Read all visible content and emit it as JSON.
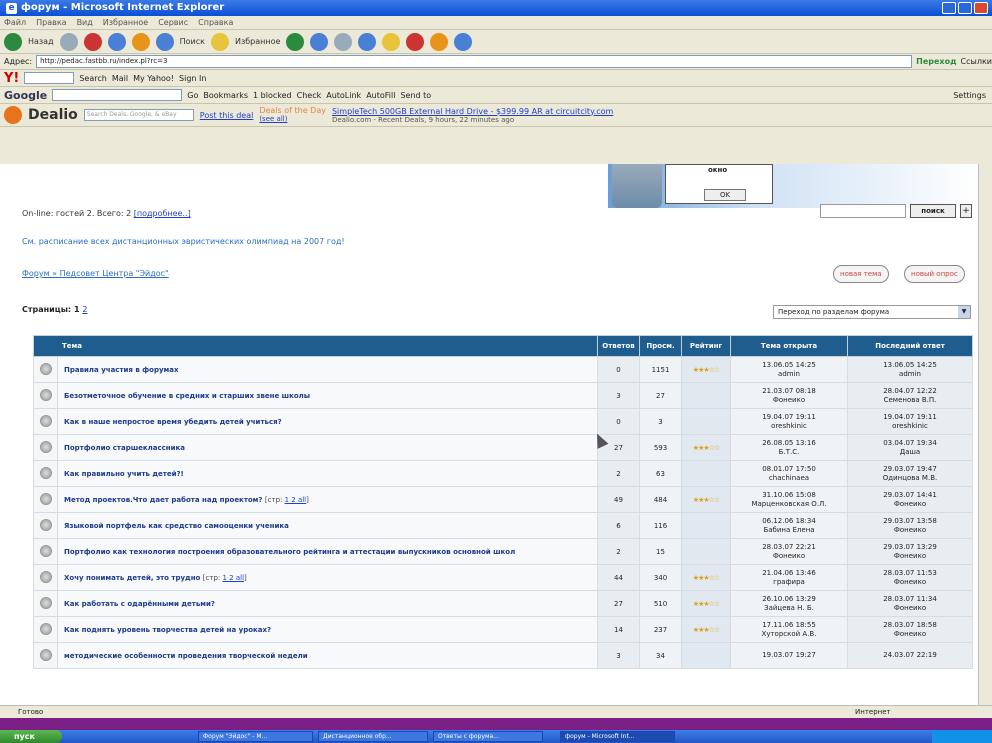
{
  "window": {
    "title": "форум - Microsoft Internet Explorer"
  },
  "menu": [
    "Файл",
    "Правка",
    "Вид",
    "Избранное",
    "Сервис",
    "Справка"
  ],
  "toolbar": {
    "back": "Назад",
    "search": "Поиск",
    "favorites": "Избранное"
  },
  "address": {
    "label": "Адрес:",
    "url": "http://pedac.fastbb.ru/index.pl?rc=3",
    "go": "Переход",
    "links": "Ссылки"
  },
  "yahoo": {
    "search": "Search",
    "mail": "Mail",
    "my_yahoo": "My Yahoo!",
    "signin": "Sign In"
  },
  "google": {
    "go": "Go",
    "bookmarks": "Bookmarks",
    "blocked": "1 blocked",
    "check": "Check",
    "autolink": "AutoLink",
    "autofill": "AutoFill",
    "sendto": "Send to",
    "settings": "Settings"
  },
  "dealio": {
    "brand": "Dealio",
    "search_placeholder": "Search Deals, Google, & eBay",
    "post": "Post this deal",
    "deals_day": "Deals of the Day",
    "see_all": "(see all)",
    "deal_link": "SimpleTech 500GB External Hard Drive - $399.99 AR at circuitcity.com",
    "deal_sub": "Dealio.com - Recent Deals, 9 hours, 22 minutes ago"
  },
  "banner": {
    "dialog_label": "окно",
    "ok": "OK"
  },
  "online": {
    "text": "On-line: гостей 2. Всего: 2",
    "link": "[подробнее..]"
  },
  "search": {
    "button": "поиск",
    "plus": "+"
  },
  "announce": "См. расписание всех дистанционных эвристических олимпиад на 2007 год!",
  "breadcrumb": "Форум » Педсовет Центра \"Эйдос\"",
  "buttons": {
    "new_topic": "новая тема",
    "new_poll": "новый опрос"
  },
  "pages": {
    "label": "Страницы:",
    "current": "1",
    "other": "2"
  },
  "jump": {
    "label": "Переход по разделам форума"
  },
  "table": {
    "headers": [
      "Тема",
      "Ответов",
      "Просм.",
      "Рейтинг",
      "Тема открыта",
      "Последний ответ"
    ],
    "rows": [
      {
        "title": "Правила участия в форумах",
        "pages": "",
        "replies": "0",
        "views": "1151",
        "rating": "★★★☆☆",
        "opened": "13.06.05 14:25",
        "author": "admin",
        "last": "13.06.05 14:25",
        "last_author": "admin"
      },
      {
        "title": "Безотметочное обучение в средних и старших звене школы",
        "pages": "",
        "replies": "3",
        "views": "27",
        "rating": "",
        "opened": "21.03.07 08:18",
        "author": "Фонеико",
        "last": "28.04.07 12:22",
        "last_author": "Семенова В.П."
      },
      {
        "title": "Как в наше непростое время убедить детей учиться?",
        "pages": "",
        "replies": "0",
        "views": "3",
        "rating": "",
        "opened": "19.04.07 19:11",
        "author": "oreshkinic",
        "last": "19.04.07 19:11",
        "last_author": "oreshkinic"
      },
      {
        "title": "Портфолио старшеклассника",
        "pages": "",
        "replies": "27",
        "views": "593",
        "rating": "★★★☆☆",
        "opened": "26.08.05 13:16",
        "author": "Б.Т.С.",
        "last": "03.04.07 19:34",
        "last_author": "Даша"
      },
      {
        "title": "Как правильно учить детей?!",
        "pages": "",
        "replies": "2",
        "views": "63",
        "rating": "",
        "opened": "08.01.07 17:50",
        "author": "chachinaea",
        "last": "29.03.07 19:47",
        "last_author": "Одинцова М.В."
      },
      {
        "title": "Метод проектов.Что дает работа над проектом?",
        "pages": "1 2 all",
        "replies": "49",
        "views": "484",
        "rating": "★★★☆☆",
        "opened": "31.10.06 15:08",
        "author": "Марценковская О.Л.",
        "last": "29.03.07 14:41",
        "last_author": "Фонеико"
      },
      {
        "title": "Языковой портфель как средство самооценки ученика",
        "pages": "",
        "replies": "6",
        "views": "116",
        "rating": "",
        "opened": "06.12.06 18:34",
        "author": "Бабина Елена",
        "last": "29.03.07 13:58",
        "last_author": "Фонеико"
      },
      {
        "title": "Портфолио как технология построения образовательного рейтинга и аттестации выпускников основной школ",
        "pages": "",
        "replies": "2",
        "views": "15",
        "rating": "",
        "opened": "28.03.07 22:21",
        "author": "Фонеико",
        "last": "29.03.07 13:29",
        "last_author": "Фонеико"
      },
      {
        "title": "Хочу понимать детей, это трудно",
        "pages": "1 2 all",
        "replies": "44",
        "views": "340",
        "rating": "★★★☆☆",
        "opened": "21.04.06 13:46",
        "author": "графира",
        "last": "28.03.07 11:53",
        "last_author": "Фонеико"
      },
      {
        "title": "Как работать с одарёнными детьми?",
        "pages": "",
        "replies": "27",
        "views": "510",
        "rating": "★★★☆☆",
        "opened": "26.10.06 13:29",
        "author": "Зайцева Н. Б.",
        "last": "28.03.07 11:34",
        "last_author": "Фонеико"
      },
      {
        "title": "Как поднять уровень творчества детей на уроках?",
        "pages": "",
        "replies": "14",
        "views": "237",
        "rating": "★★★☆☆",
        "opened": "17.11.06 18:55",
        "author": "Хуторской А.В.",
        "last": "28.03.07 18:58",
        "last_author": "Фонеико"
      },
      {
        "title": "методические особенности проведения творческой недели",
        "pages": "",
        "replies": "3",
        "views": "34",
        "rating": "",
        "opened": "19.03.07 19:27",
        "author": "",
        "last": "24.03.07 22:19",
        "last_author": ""
      }
    ]
  },
  "status": {
    "left": "Готово",
    "zone": "Интернет"
  },
  "taskbar": {
    "start": "пуск",
    "tasks": [
      "Форум \"Эйдос\" - M...",
      "Дистанционное обр...",
      "Ответы с форума...",
      "форум - Microsoft Int..."
    ]
  }
}
